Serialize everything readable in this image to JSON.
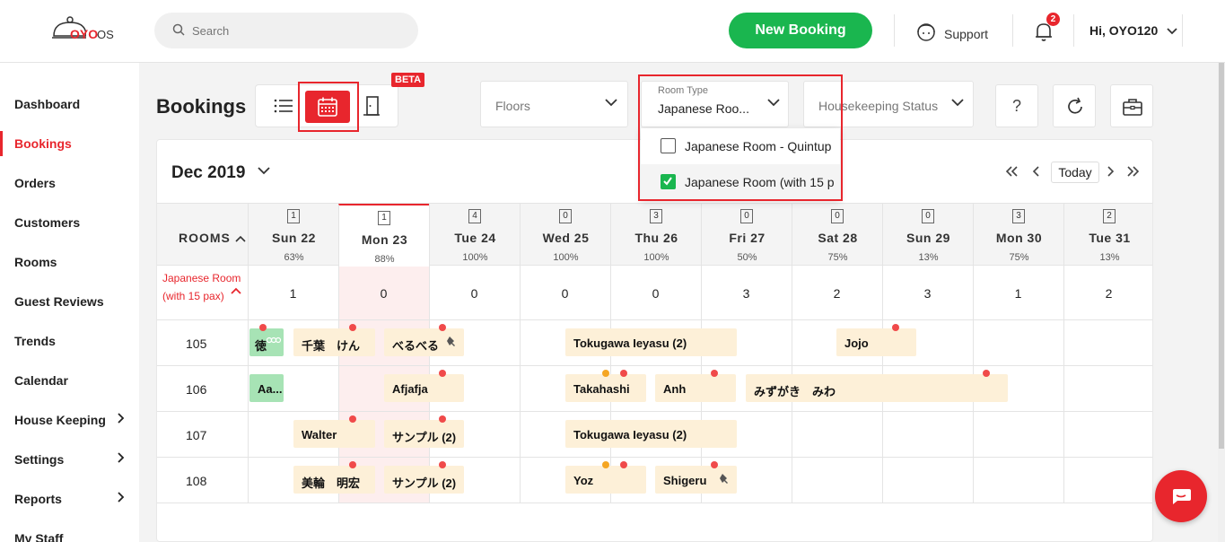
{
  "app": {
    "logo_text": "OYO",
    "logo_suffix": "OS"
  },
  "header": {
    "search_placeholder": "Search",
    "new_booking": "New Booking",
    "support": "Support",
    "notifications": "2",
    "user": "Hi, OYO120"
  },
  "sidebar": {
    "items": [
      {
        "label": "Dashboard"
      },
      {
        "label": "Bookings"
      },
      {
        "label": "Orders"
      },
      {
        "label": "Customers"
      },
      {
        "label": "Rooms"
      },
      {
        "label": "Guest Reviews"
      },
      {
        "label": "Trends"
      },
      {
        "label": "Calendar"
      },
      {
        "label": "House Keeping"
      },
      {
        "label": "Settings"
      },
      {
        "label": "Reports"
      },
      {
        "label": "My Staff"
      }
    ],
    "active": "Bookings"
  },
  "toolbar": {
    "title": "Bookings",
    "beta": "BETA",
    "floors": "Floors",
    "room_type_label": "Room Type",
    "room_type_value": "Japanese Roo...",
    "housekeeping": "Housekeeping Status",
    "help": "?"
  },
  "room_type_options": [
    {
      "label": "Japanese Room - Quintup",
      "checked": false
    },
    {
      "label": "Japanese Room (with 15 p",
      "checked": true
    }
  ],
  "calendar": {
    "month": "Dec 2019",
    "today_button": "Today",
    "rooms_header": "ROOMS",
    "days": [
      {
        "count": "1",
        "name": "Sun 22",
        "pct": "63%"
      },
      {
        "count": "1",
        "name": "Mon 23",
        "pct": "88%"
      },
      {
        "count": "4",
        "name": "Tue 24",
        "pct": "100%"
      },
      {
        "count": "0",
        "name": "Wed 25",
        "pct": "100%"
      },
      {
        "count": "3",
        "name": "Thu 26",
        "pct": "100%"
      },
      {
        "count": "0",
        "name": "Fri 27",
        "pct": "50%"
      },
      {
        "count": "0",
        "name": "Sat 28",
        "pct": "75%"
      },
      {
        "count": "0",
        "name": "Sun 29",
        "pct": "13%"
      },
      {
        "count": "3",
        "name": "Mon 30",
        "pct": "75%"
      },
      {
        "count": "2",
        "name": "Tue 31",
        "pct": "13%"
      }
    ],
    "room_type": "Japanese Room (with 15 pax)",
    "availability": [
      "1",
      "0",
      "0",
      "0",
      "0",
      "3",
      "2",
      "3",
      "1",
      "2"
    ],
    "rooms": [
      "105",
      "106",
      "107",
      "108"
    ],
    "bookings": {
      "r105": [
        "徳",
        "千葉　けん",
        "べるべる",
        "Tokugawa Ieyasu  (2)",
        "Jojo"
      ],
      "r106": [
        "Aa...",
        "Afjafja",
        "Takahashi",
        "Anh",
        "みずがき　みわ"
      ],
      "r107": [
        "Walter",
        "サンプル  (2)",
        "Tokugawa Ieyasu  (2)"
      ],
      "r108": [
        "美輪　明宏",
        "サンプル  (2)",
        "Yoz",
        "Shigeru"
      ]
    }
  },
  "colors": {
    "brand": "#e8262d",
    "green": "#1ab64f",
    "booking": "#fdf0d8",
    "checked_in": "#a7e3b5"
  }
}
